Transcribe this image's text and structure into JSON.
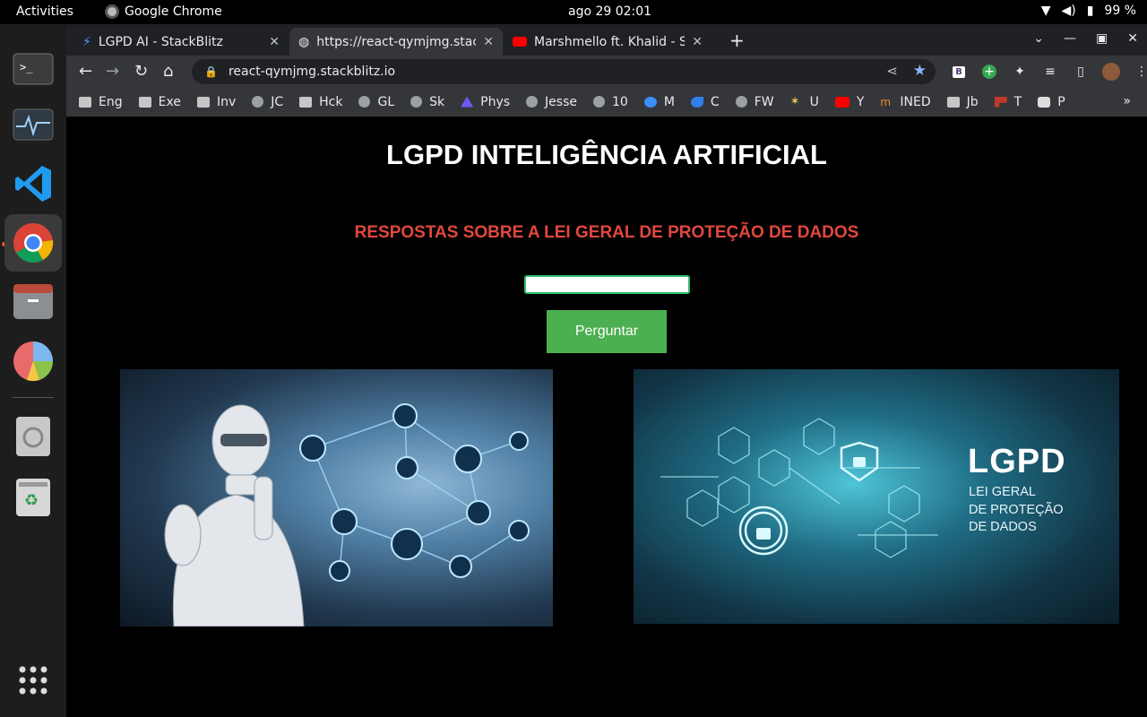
{
  "system": {
    "activities": "Activities",
    "app_name": "Google Chrome",
    "clock": "ago 29  02:01",
    "battery": "99 %"
  },
  "tabs": [
    {
      "title": "LGPD AI - StackBlitz",
      "icon": "stackblitz-bolt-icon"
    },
    {
      "title": "https://react-qymjmg.stac",
      "icon": "globe-icon"
    },
    {
      "title": "Marshmello ft. Khalid - Sil",
      "icon": "youtube-icon"
    }
  ],
  "omnibox": {
    "url": "react-qymjmg.stackblitz.io"
  },
  "bookmarks": [
    {
      "label": "Eng",
      "icon": "folder"
    },
    {
      "label": "Exe",
      "icon": "folder"
    },
    {
      "label": "Inv",
      "icon": "folder"
    },
    {
      "label": "JC",
      "icon": "globe"
    },
    {
      "label": "Hck",
      "icon": "folder"
    },
    {
      "label": "GL",
      "icon": "globe"
    },
    {
      "label": "Sk",
      "icon": "globe"
    },
    {
      "label": "Phys",
      "icon": "globe"
    },
    {
      "label": "Jesse",
      "icon": "globe"
    },
    {
      "label": "10",
      "icon": "globe"
    },
    {
      "label": "M",
      "icon": "globe"
    },
    {
      "label": "C",
      "icon": "globe"
    },
    {
      "label": "FW",
      "icon": "globe"
    },
    {
      "label": "U",
      "icon": "globe"
    },
    {
      "label": "Y",
      "icon": "youtube"
    },
    {
      "label": "INED",
      "icon": "globe"
    },
    {
      "label": "Jb",
      "icon": "folder"
    },
    {
      "label": "T",
      "icon": "globe"
    },
    {
      "label": "P",
      "icon": "globe"
    }
  ],
  "page": {
    "title": "LGPD INTELIGÊNCIA ARTIFICIAL",
    "subtitle": "RESPOSTAS SOBRE A LEI GERAL DE PROTEÇÃO DE DADOS",
    "question_value": "",
    "ask_button": "Perguntar",
    "image2_heading": "LGPD",
    "image2_sub": [
      "LEI GERAL",
      "DE PROTEÇÃO",
      "DE DADOS"
    ]
  },
  "colors": {
    "subtitle": "#e0483e",
    "button": "#4caf50",
    "input_border": "#2fbf71"
  }
}
